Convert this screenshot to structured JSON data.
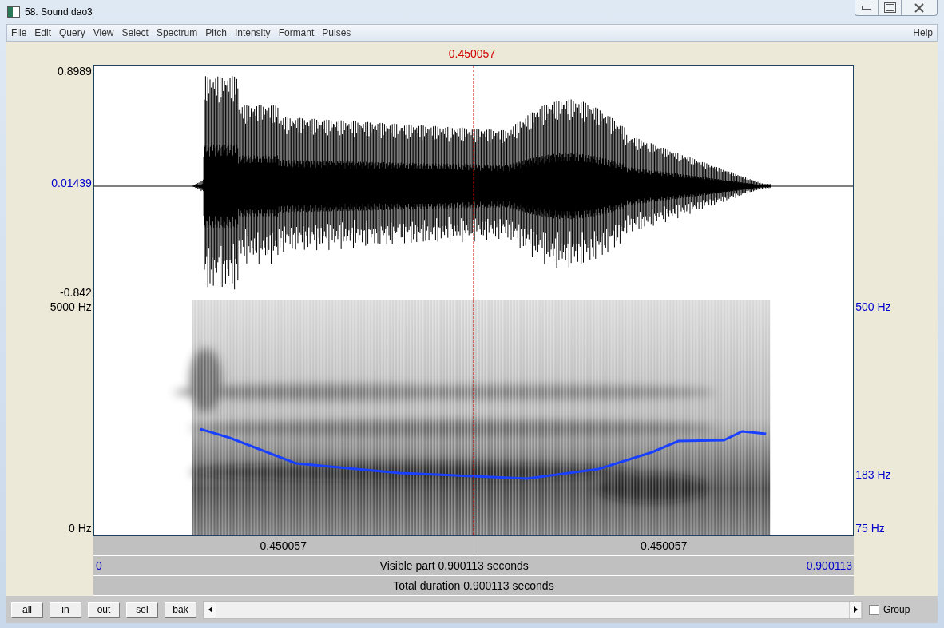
{
  "window": {
    "title": "58. Sound dao3"
  },
  "menu": {
    "items": [
      "File",
      "Edit",
      "Query",
      "View",
      "Select",
      "Spectrum",
      "Pitch",
      "Intensity",
      "Formant",
      "Pulses"
    ],
    "help": "Help"
  },
  "cursor_time": "0.450057",
  "waveform": {
    "max": "0.8989",
    "cursor_value": "0.01439",
    "min": "-0.842"
  },
  "spectrogram": {
    "top": "5000 Hz",
    "bottom": "0 Hz"
  },
  "pitch_axis": {
    "top": "500 Hz",
    "middle": "183 Hz",
    "bottom": "75 Hz"
  },
  "time_rows": {
    "left_part": "0.450057",
    "right_part": "0.450057",
    "start": "0",
    "visible": "Visible part 0.900113 seconds",
    "end": "0.900113",
    "total": "Total duration 0.900113 seconds"
  },
  "buttons": [
    "all",
    "in",
    "out",
    "sel",
    "bak"
  ],
  "group": {
    "label": "Group",
    "checked": false
  }
}
